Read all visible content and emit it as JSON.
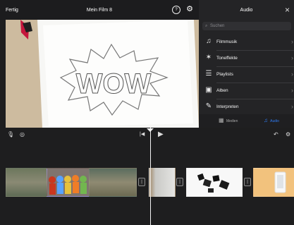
{
  "topbar": {
    "done_label": "Fertig",
    "title": "Mein Film 8",
    "help_icon": "?",
    "settings_icon": "⚙"
  },
  "audio_panel": {
    "title": "Audio",
    "close_icon": "×",
    "search": {
      "placeholder": "Suchen"
    },
    "items": [
      {
        "label": "Filmmusik",
        "icon": "music-note-icon",
        "glyph": "♫"
      },
      {
        "label": "Toneffekte",
        "icon": "sparkle-icon",
        "glyph": "✶"
      },
      {
        "label": "Playlists",
        "icon": "playlist-icon",
        "glyph": "☰"
      },
      {
        "label": "Alben",
        "icon": "album-icon",
        "glyph": "▣"
      },
      {
        "label": "Interpreten",
        "icon": "microphone-icon",
        "glyph": "✎"
      }
    ],
    "tabs": [
      {
        "label": "Medien",
        "icon": "media-icon",
        "glyph": "▦"
      },
      {
        "label": "Audio",
        "icon": "audio-icon",
        "glyph": "♫"
      }
    ],
    "accent": "#2f7df6"
  },
  "preview": {
    "drawing_text": "WOW"
  },
  "toolbar": {
    "mic_icon": "🎙",
    "camera_icon": "◎",
    "skip_icon": "|◀",
    "play_icon": "▶",
    "undo_icon": "↶",
    "settings_icon": "⚙"
  },
  "timeline": {
    "transition_glyph": "|"
  }
}
